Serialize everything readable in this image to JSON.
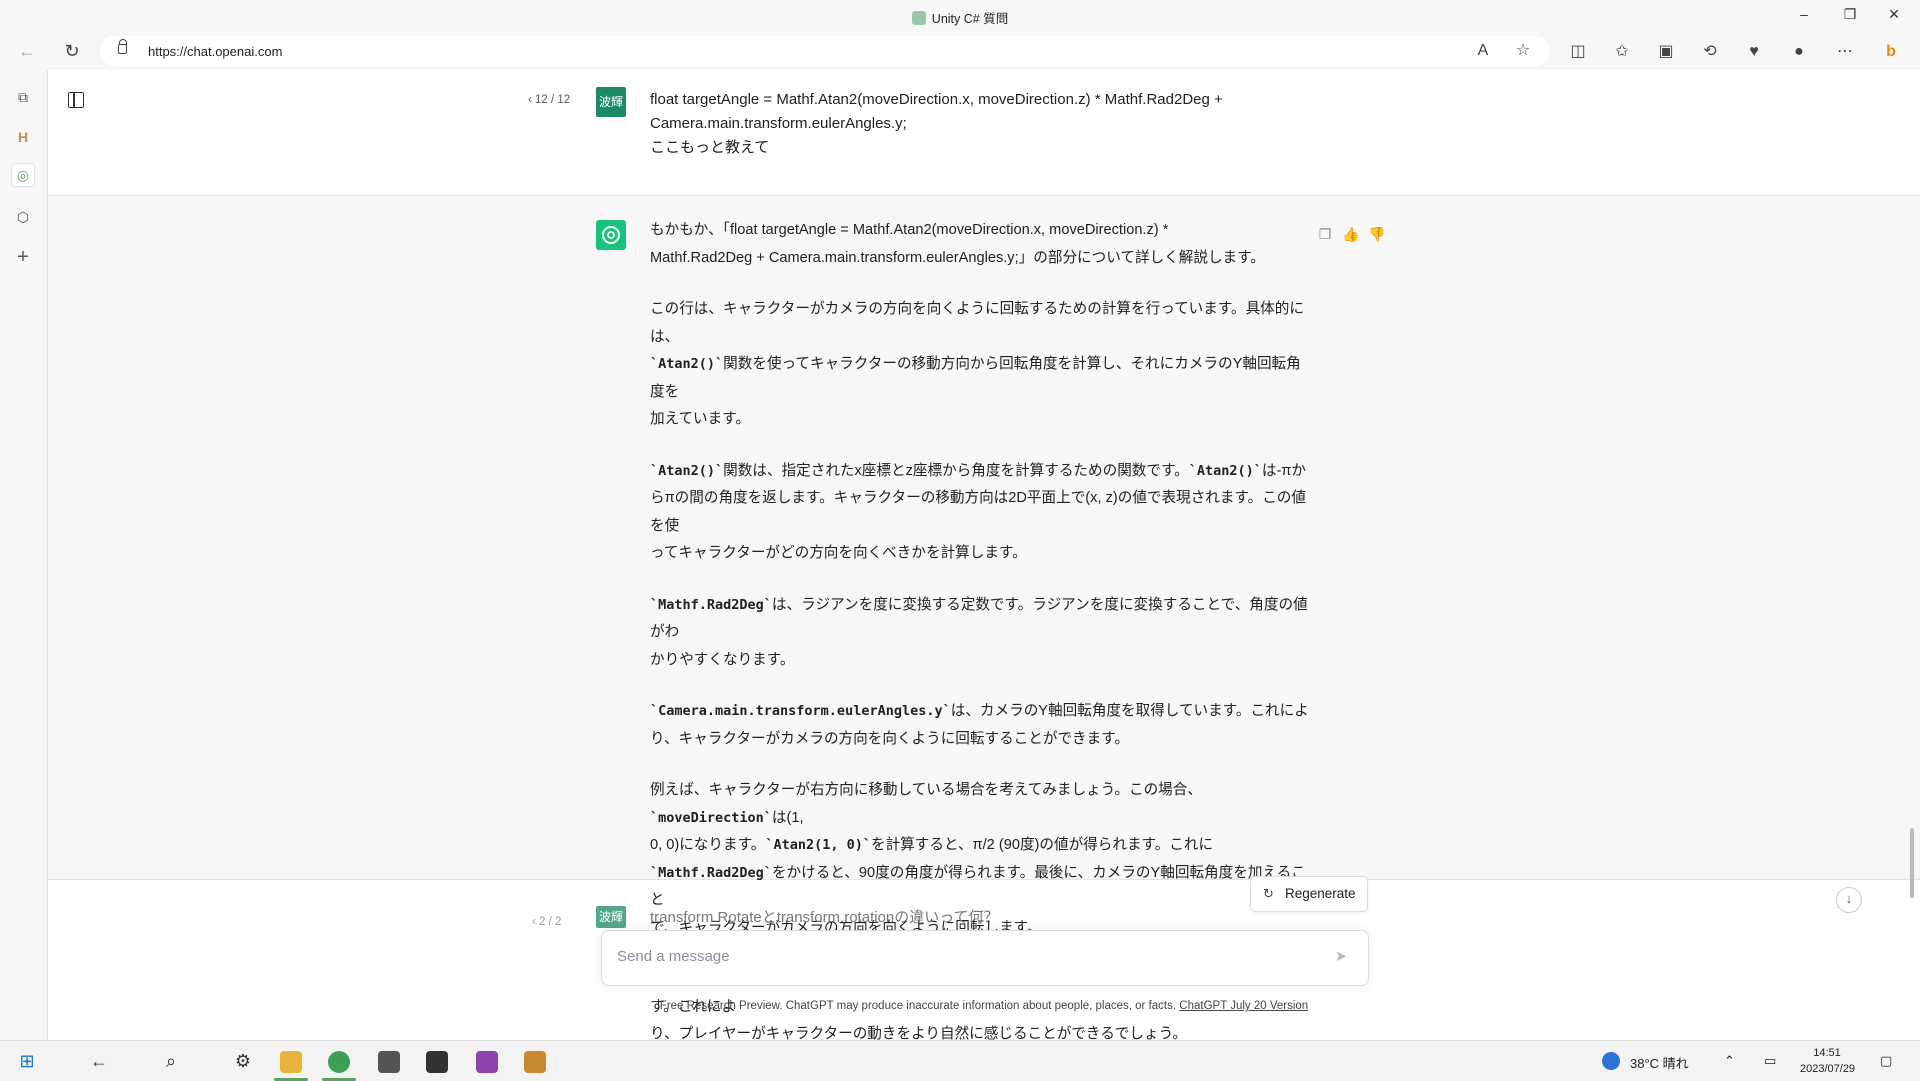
{
  "window": {
    "title": "Unity C# 質問",
    "minimize": "–",
    "restore": "❐",
    "close": "✕"
  },
  "browser": {
    "url": "https://chat.openai.com",
    "back": "←",
    "refresh": "↻"
  },
  "conversation": {
    "user_message": {
      "pager": "12 / 12",
      "avatar": "波輝",
      "lines": [
        "float targetAngle = Mathf.Atan2(moveDirection.x, moveDirection.z) * Mathf.Rad2Deg +",
        "Camera.main.transform.eulerAngles.y;",
        "ここもっと教えて"
      ]
    },
    "assistant_message": {
      "intro_line1": "もかもか、「float targetAngle = Mathf.Atan2(moveDirection.x, moveDirection.z) *",
      "intro_line2": "Mathf.Rad2Deg + Camera.main.transform.eulerAngles.y;」の部分について詳しく解説します。",
      "p1_a": "この行は、キャラクターがカメラの方向を向くように回転するための計算を行っています。具体的には、",
      "p1_code": "`Atan2()`",
      "p1_b": "関数を使ってキャラクターの移動方向から回転角度を計算し、それにカメラのY軸回転角度を",
      "p1_c": "加えています。",
      "p2_code1": "`Atan2()`",
      "p2_a": "関数は、指定されたx座標とz座標から角度を計算するための関数です。",
      "p2_code2": "`Atan2()`",
      "p2_b": "は-πか",
      "p2_c": "らπの間の角度を返します。キャラクターの移動方向は2D平面上で(x, z)の値で表現されます。この値を使",
      "p2_d": "ってキャラクターがどの方向を向くべきかを計算します。",
      "p3_code": "`Mathf.Rad2Deg`",
      "p3_a": "は、ラジアンを度に変換する定数です。ラジアンを度に変換することで、角度の値がわ",
      "p3_b": "かりやすくなります。",
      "p4_code": "`Camera.main.transform.eulerAngles.y`",
      "p4_a": "は、カメラのY軸回転角度を取得しています。これによ",
      "p4_b": "り、キャラクターがカメラの方向を向くように回転することができます。",
      "p5_a": "例えば、キャラクターが右方向に移動している場合を考えてみましょう。この場合、",
      "p5_code1": "`moveDirection`",
      "p5_b": "は(1,",
      "p5_c": "0, 0)になります。",
      "p5_code2": "`Atan2(1, 0)`",
      "p5_d": "を計算すると、π/2 (90度)の値が得られます。これに",
      "p5_code3": "`Mathf.Rad2Deg`",
      "p5_e": "をかけると、90度の角度が得られます。最後に、カメラのY軸回転角度を加えること",
      "p5_f": "で、キャラクターがカメラの方向を向くように回転します。",
      "p6_a": "このようにして、キャラクターが移動方向に応じてカメラの方向を向くように回転することができます。これによ",
      "p6_b": "り、プレイヤーがキャラクターの動きをより自然に感じることができるでしょう。"
    },
    "next_user_message": {
      "pager": "2 / 2",
      "avatar": "波輝",
      "text": "transform.Rotateとtransform.rotationの違いって何？"
    }
  },
  "regenerate_label": "Regenerate",
  "composer": {
    "placeholder": "Send a message"
  },
  "footer": {
    "text": "Free Research Preview. ChatGPT may produce inaccurate information about people, places, or facts.",
    "link": "ChatGPT July 20 Version"
  },
  "taskbar": {
    "weather": "38°C  晴れ",
    "time": "14:51",
    "date": "2023/07/29"
  },
  "colors": {
    "user_avatar": "#1a8a68",
    "gpt_avatar": "#19c37d",
    "assistant_bg": "#f7f7f8"
  }
}
